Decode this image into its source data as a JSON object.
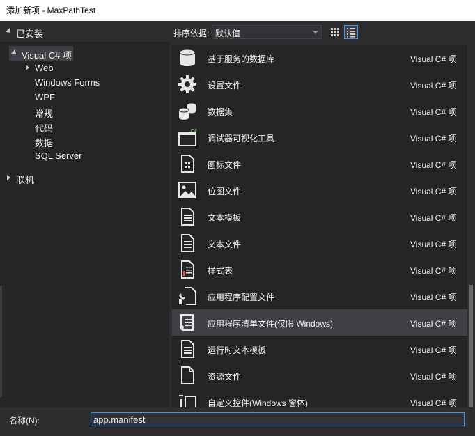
{
  "window": {
    "title": "添加新项 - MaxPathTest"
  },
  "sidebar": {
    "installed_label": "已安装",
    "tree": [
      {
        "label": "Visual C# 项",
        "selected": true
      },
      {
        "label": "Web"
      },
      {
        "label": "Windows Forms"
      },
      {
        "label": "WPF"
      },
      {
        "label": "常规"
      },
      {
        "label": "代码"
      },
      {
        "label": "数据"
      },
      {
        "label": "SQL Server"
      }
    ],
    "online_label": "联机"
  },
  "toolbar": {
    "sort_label": "排序依据:",
    "sort_value": "默认值",
    "views": [
      "grid-view-icon",
      "list-view-icon"
    ],
    "active_view": "list-view-icon"
  },
  "items": [
    {
      "name": "基于服务的数据库",
      "lang": "Visual C# 项",
      "icon": "database-icon"
    },
    {
      "name": "设置文件",
      "lang": "Visual C# 项",
      "icon": "gear-icon"
    },
    {
      "name": "数据集",
      "lang": "Visual C# 项",
      "icon": "dataset-icon"
    },
    {
      "name": "调试器可视化工具",
      "lang": "Visual C# 项",
      "icon": "debugger-visualizer-icon"
    },
    {
      "name": "图标文件",
      "lang": "Visual C# 项",
      "icon": "icon-file-icon"
    },
    {
      "name": "位图文件",
      "lang": "Visual C# 项",
      "icon": "bitmap-icon"
    },
    {
      "name": "文本模板",
      "lang": "Visual C# 项",
      "icon": "text-template-icon"
    },
    {
      "name": "文本文件",
      "lang": "Visual C# 项",
      "icon": "text-file-icon"
    },
    {
      "name": "样式表",
      "lang": "Visual C# 项",
      "icon": "stylesheet-icon"
    },
    {
      "name": "应用程序配置文件",
      "lang": "Visual C# 项",
      "icon": "app-config-icon"
    },
    {
      "name": "应用程序清单文件(仅限 Windows)",
      "lang": "Visual C# 项",
      "icon": "manifest-icon",
      "selected": true
    },
    {
      "name": "运行时文本模板",
      "lang": "Visual C# 项",
      "icon": "runtime-template-icon"
    },
    {
      "name": "资源文件",
      "lang": "Visual C# 项",
      "icon": "resource-file-icon"
    },
    {
      "name": "自定义控件(Windows 窗体)",
      "lang": "Visual C# 项",
      "icon": "custom-control-icon"
    }
  ],
  "footer": {
    "name_label": "名称(N):",
    "name_value": "app.manifest"
  },
  "colors": {
    "background": "#2d2d30",
    "panel": "#252526",
    "selection": "#3f3f46",
    "accent": "#3399ff"
  }
}
